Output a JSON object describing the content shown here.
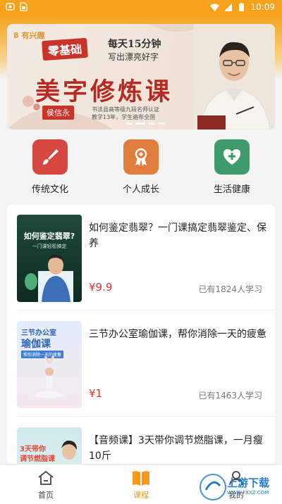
{
  "status_bar": {
    "time": "10:09"
  },
  "banner": {
    "logo_text": "8 有兴趣",
    "badge": "零基础",
    "tagline_1": "每天15分钟",
    "tagline_2": "写出漂亮好字",
    "headline": "美字修炼课",
    "teacher_name": "侯信永",
    "desc_1": "书法县高等级九段名师认证",
    "desc_2": "教学13年，学生遍布全国",
    "active_slide": 1,
    "slide_count": 4
  },
  "categories": [
    {
      "label": "传统文化",
      "icon": "brush-icon",
      "color": "#d4483f"
    },
    {
      "label": "个人成长",
      "icon": "award-ribbon-icon",
      "color": "#e07c3d"
    },
    {
      "label": "生活健康",
      "icon": "heart-plus-icon",
      "color": "#3f9a6b"
    }
  ],
  "courses": [
    {
      "title": "如何鉴定翡翠？一门课搞定翡翠鉴定、保养",
      "price": "¥9.9",
      "learners": "已有1824人学习",
      "thumb_heading": "如何鉴定翡翠?",
      "thumb_sub": "一门课轻松搞定"
    },
    {
      "title": "三节办公室瑜伽课，帮你消除一天的疲惫",
      "price": "¥1",
      "learners": "已有1463人学习",
      "thumb_heading": "三节办公室",
      "thumb_heading_2": "瑜伽课",
      "thumb_sub": "帮你消除一天的疲惫"
    },
    {
      "title": "【音频课】3天带你调节燃脂课，一月瘦10斤",
      "price": "",
      "learners": "",
      "thumb_heading": "3天带你",
      "thumb_sub": "调节燃脂课"
    }
  ],
  "tabs": [
    {
      "label": "首页",
      "icon": "home-icon",
      "active": false
    },
    {
      "label": "课程",
      "icon": "book-icon",
      "active": true
    },
    {
      "label": "我的",
      "icon": "user-icon",
      "active": false
    }
  ],
  "watermark": {
    "text": "上游下载",
    "url_text": "WWW.FXXZ.COM"
  },
  "colors": {
    "accent": "#f7a21b",
    "price": "#e0352b"
  }
}
